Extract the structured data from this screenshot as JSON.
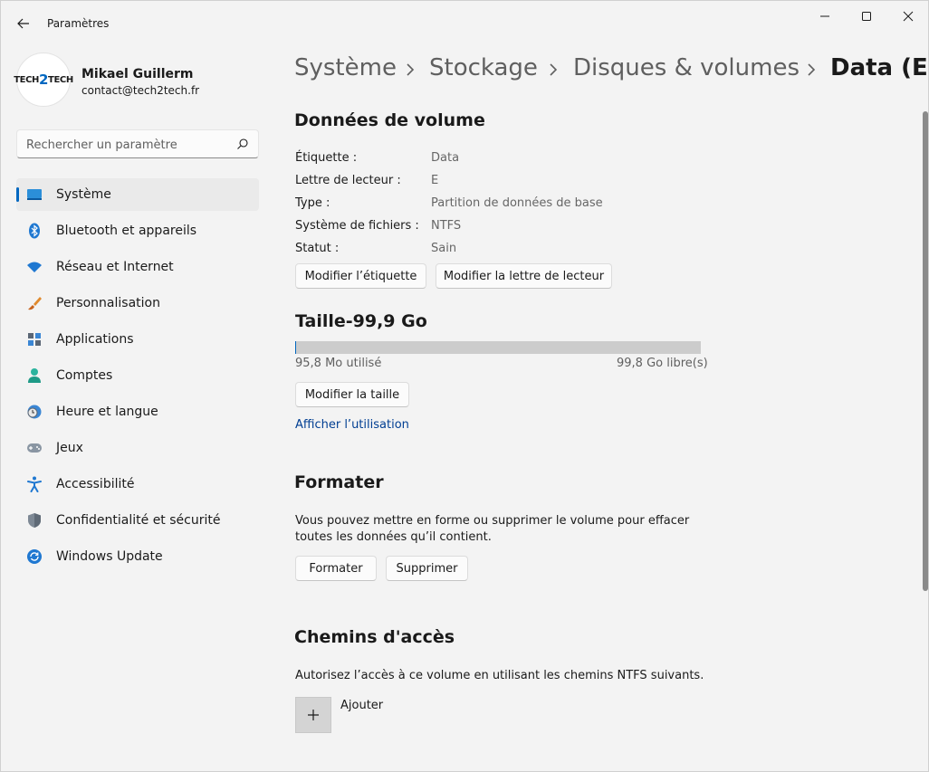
{
  "window": {
    "app_title": "Paramètres",
    "accent_color": "#0067c0"
  },
  "profile": {
    "avatar_text_a": "TECH",
    "avatar_text_b": "2",
    "avatar_text_c": "TECH",
    "name": "Mikael Guillerm",
    "email": "contact@tech2tech.fr"
  },
  "search": {
    "placeholder": "Rechercher un paramètre"
  },
  "sidebar": {
    "items": [
      {
        "label": "Système",
        "icon": "monitor-icon",
        "selected": true
      },
      {
        "label": "Bluetooth et appareils",
        "icon": "bluetooth-icon"
      },
      {
        "label": "Réseau et Internet",
        "icon": "wifi-icon"
      },
      {
        "label": "Personnalisation",
        "icon": "brush-icon"
      },
      {
        "label": "Applications",
        "icon": "apps-icon"
      },
      {
        "label": "Comptes",
        "icon": "person-icon"
      },
      {
        "label": "Heure et langue",
        "icon": "clock-globe-icon"
      },
      {
        "label": "Jeux",
        "icon": "gamepad-icon"
      },
      {
        "label": "Accessibilité",
        "icon": "accessibility-icon"
      },
      {
        "label": "Confidentialité et sécurité",
        "icon": "shield-icon"
      },
      {
        "label": "Windows Update",
        "icon": "update-icon"
      }
    ]
  },
  "breadcrumb": {
    "items": [
      "Système",
      "Stockage",
      "Disques & volumes",
      "Data (E:)"
    ]
  },
  "volume": {
    "title": "Données de volume",
    "props": [
      {
        "label": "Étiquette :",
        "value": "Data"
      },
      {
        "label": "Lettre de lecteur :",
        "value": "E"
      },
      {
        "label": "Type :",
        "value": "Partition de données de base"
      },
      {
        "label": "Système de fichiers :",
        "value": "NTFS"
      },
      {
        "label": "Statut :",
        "value": "Sain"
      }
    ],
    "rename_button": "Modifier l’étiquette",
    "letter_button": "Modifier la lettre de lecteur"
  },
  "size": {
    "title": "Taille-99,9 Go",
    "used_text": "95,8 Mo utilisé",
    "free_text": "99,8 Go libre(s)",
    "used_fraction": 0.001,
    "resize_button": "Modifier la taille",
    "usage_link": "Afficher l’utilisation"
  },
  "format": {
    "title": "Formater",
    "description_line1": "Vous pouvez mettre en forme ou supprimer le volume pour effacer",
    "description_line2": "toutes les données qu’il contient.",
    "format_button": "Formater",
    "delete_button": "Supprimer"
  },
  "paths": {
    "title": "Chemins d'accès",
    "description": "Autorisez l’accès à ce volume en utilisant les chemins NTFS suivants.",
    "add_label": "Ajouter"
  }
}
